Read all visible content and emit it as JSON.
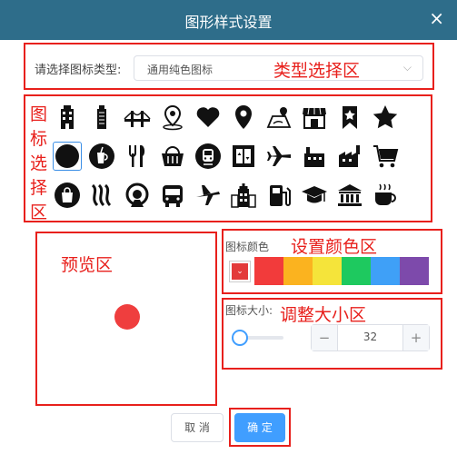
{
  "dialog": {
    "title": "图形样式设置",
    "close": "×"
  },
  "type_section": {
    "label": "请选择图标类型:",
    "selected": "通用纯色图标",
    "annotation": "类型选择区"
  },
  "icons": {
    "annotation_chars": [
      "图",
      "标",
      "选",
      "择",
      "区"
    ],
    "rows": [
      [
        "building-icon",
        "tower-icon",
        "bridge-icon",
        "map-pin-person-icon",
        "heart-icon",
        "location-pin-icon",
        "map-route-icon",
        "shop-icon",
        "bookmark-star-icon",
        "star-icon"
      ],
      [
        "circle-icon",
        "drink-icon",
        "fork-knife-icon",
        "basket-icon",
        "subway-icon",
        "elevator-icon",
        "airplane-icon",
        "factory-icon",
        "factory-chimney-icon",
        "cart-icon"
      ],
      [
        "shopping-bag-icon",
        "wave-icon",
        "station-icon",
        "bus-icon",
        "airplane-right-icon",
        "hospital-building-icon",
        "gas-station-icon",
        "graduation-cap-icon",
        "bank-icon",
        "coffee-icon"
      ]
    ],
    "selected": "circle-icon"
  },
  "preview": {
    "annotation": "预览区"
  },
  "color": {
    "label": "图标颜色",
    "annotation": "设置颜色区",
    "current": "#e33a3a",
    "swatches": [
      "#f23b3b",
      "#fbb31f",
      "#f5e43a",
      "#1ec95f",
      "#3fa0f7",
      "#7d4aab"
    ]
  },
  "size": {
    "label": "图标大小:",
    "annotation": "调整大小区",
    "value": "32",
    "minus": "−",
    "plus": "+"
  },
  "buttons": {
    "cancel": "取 消",
    "ok": "确 定"
  }
}
